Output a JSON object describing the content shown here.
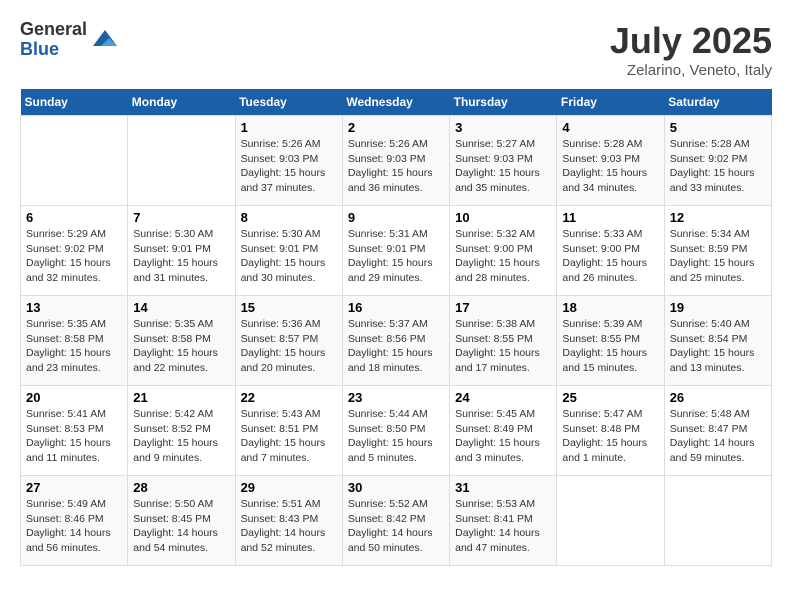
{
  "logo": {
    "general": "General",
    "blue": "Blue"
  },
  "title": "July 2025",
  "location": "Zelarino, Veneto, Italy",
  "weekdays": [
    "Sunday",
    "Monday",
    "Tuesday",
    "Wednesday",
    "Thursday",
    "Friday",
    "Saturday"
  ],
  "weeks": [
    [
      {
        "day": "",
        "info": ""
      },
      {
        "day": "",
        "info": ""
      },
      {
        "day": "1",
        "info": "Sunrise: 5:26 AM\nSunset: 9:03 PM\nDaylight: 15 hours\nand 37 minutes."
      },
      {
        "day": "2",
        "info": "Sunrise: 5:26 AM\nSunset: 9:03 PM\nDaylight: 15 hours\nand 36 minutes."
      },
      {
        "day": "3",
        "info": "Sunrise: 5:27 AM\nSunset: 9:03 PM\nDaylight: 15 hours\nand 35 minutes."
      },
      {
        "day": "4",
        "info": "Sunrise: 5:28 AM\nSunset: 9:03 PM\nDaylight: 15 hours\nand 34 minutes."
      },
      {
        "day": "5",
        "info": "Sunrise: 5:28 AM\nSunset: 9:02 PM\nDaylight: 15 hours\nand 33 minutes."
      }
    ],
    [
      {
        "day": "6",
        "info": "Sunrise: 5:29 AM\nSunset: 9:02 PM\nDaylight: 15 hours\nand 32 minutes."
      },
      {
        "day": "7",
        "info": "Sunrise: 5:30 AM\nSunset: 9:01 PM\nDaylight: 15 hours\nand 31 minutes."
      },
      {
        "day": "8",
        "info": "Sunrise: 5:30 AM\nSunset: 9:01 PM\nDaylight: 15 hours\nand 30 minutes."
      },
      {
        "day": "9",
        "info": "Sunrise: 5:31 AM\nSunset: 9:01 PM\nDaylight: 15 hours\nand 29 minutes."
      },
      {
        "day": "10",
        "info": "Sunrise: 5:32 AM\nSunset: 9:00 PM\nDaylight: 15 hours\nand 28 minutes."
      },
      {
        "day": "11",
        "info": "Sunrise: 5:33 AM\nSunset: 9:00 PM\nDaylight: 15 hours\nand 26 minutes."
      },
      {
        "day": "12",
        "info": "Sunrise: 5:34 AM\nSunset: 8:59 PM\nDaylight: 15 hours\nand 25 minutes."
      }
    ],
    [
      {
        "day": "13",
        "info": "Sunrise: 5:35 AM\nSunset: 8:58 PM\nDaylight: 15 hours\nand 23 minutes."
      },
      {
        "day": "14",
        "info": "Sunrise: 5:35 AM\nSunset: 8:58 PM\nDaylight: 15 hours\nand 22 minutes."
      },
      {
        "day": "15",
        "info": "Sunrise: 5:36 AM\nSunset: 8:57 PM\nDaylight: 15 hours\nand 20 minutes."
      },
      {
        "day": "16",
        "info": "Sunrise: 5:37 AM\nSunset: 8:56 PM\nDaylight: 15 hours\nand 18 minutes."
      },
      {
        "day": "17",
        "info": "Sunrise: 5:38 AM\nSunset: 8:55 PM\nDaylight: 15 hours\nand 17 minutes."
      },
      {
        "day": "18",
        "info": "Sunrise: 5:39 AM\nSunset: 8:55 PM\nDaylight: 15 hours\nand 15 minutes."
      },
      {
        "day": "19",
        "info": "Sunrise: 5:40 AM\nSunset: 8:54 PM\nDaylight: 15 hours\nand 13 minutes."
      }
    ],
    [
      {
        "day": "20",
        "info": "Sunrise: 5:41 AM\nSunset: 8:53 PM\nDaylight: 15 hours\nand 11 minutes."
      },
      {
        "day": "21",
        "info": "Sunrise: 5:42 AM\nSunset: 8:52 PM\nDaylight: 15 hours\nand 9 minutes."
      },
      {
        "day": "22",
        "info": "Sunrise: 5:43 AM\nSunset: 8:51 PM\nDaylight: 15 hours\nand 7 minutes."
      },
      {
        "day": "23",
        "info": "Sunrise: 5:44 AM\nSunset: 8:50 PM\nDaylight: 15 hours\nand 5 minutes."
      },
      {
        "day": "24",
        "info": "Sunrise: 5:45 AM\nSunset: 8:49 PM\nDaylight: 15 hours\nand 3 minutes."
      },
      {
        "day": "25",
        "info": "Sunrise: 5:47 AM\nSunset: 8:48 PM\nDaylight: 15 hours\nand 1 minute."
      },
      {
        "day": "26",
        "info": "Sunrise: 5:48 AM\nSunset: 8:47 PM\nDaylight: 14 hours\nand 59 minutes."
      }
    ],
    [
      {
        "day": "27",
        "info": "Sunrise: 5:49 AM\nSunset: 8:46 PM\nDaylight: 14 hours\nand 56 minutes."
      },
      {
        "day": "28",
        "info": "Sunrise: 5:50 AM\nSunset: 8:45 PM\nDaylight: 14 hours\nand 54 minutes."
      },
      {
        "day": "29",
        "info": "Sunrise: 5:51 AM\nSunset: 8:43 PM\nDaylight: 14 hours\nand 52 minutes."
      },
      {
        "day": "30",
        "info": "Sunrise: 5:52 AM\nSunset: 8:42 PM\nDaylight: 14 hours\nand 50 minutes."
      },
      {
        "day": "31",
        "info": "Sunrise: 5:53 AM\nSunset: 8:41 PM\nDaylight: 14 hours\nand 47 minutes."
      },
      {
        "day": "",
        "info": ""
      },
      {
        "day": "",
        "info": ""
      }
    ]
  ]
}
